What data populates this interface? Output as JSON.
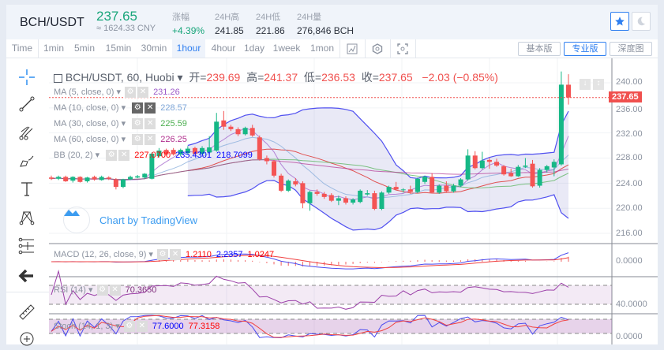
{
  "header": {
    "pair": "BCH/USDT",
    "last_price": "237.65",
    "cny": "≈ 1624.33 CNY",
    "stats": [
      {
        "label": "涨幅",
        "value": "+4.39%"
      },
      {
        "label": "24H高",
        "value": "241.85"
      },
      {
        "label": "24H低",
        "value": "221.86"
      },
      {
        "label": "24H量",
        "value": "276,846 BCH"
      }
    ],
    "favorite_icon": "star-icon",
    "theme_icon": "moon-icon"
  },
  "timeframes": [
    "Time",
    "1min",
    "5min",
    "15min",
    "30min",
    "1hour",
    "4hour",
    "1day",
    "1week",
    "1mon"
  ],
  "active_timeframe": "1hour",
  "view_buttons": [
    "基本版",
    "专业版",
    "深度图"
  ],
  "active_view": "专业版",
  "chart": {
    "title": "BCH/USDT, 60, Huobi",
    "ohlc": {
      "open_label": "开=",
      "open": "239.69",
      "high_label": "高=",
      "high": "241.37",
      "low_label": "低=",
      "low": "236.53",
      "close_label": "收=",
      "close": "237.65",
      "change": "−2.03 (−0.85%)"
    },
    "indicators": [
      {
        "label": "MA (5, close, 0)",
        "values": [
          "231.26"
        ],
        "color": "#9b59c8"
      },
      {
        "label": "MA (10, close, 0)",
        "values": [
          "228.57"
        ],
        "color": "#7ea6d8"
      },
      {
        "label": "MA (30, close, 0)",
        "values": [
          "225.59"
        ],
        "color": "#4caf50"
      },
      {
        "label": "MA (60, close, 0)",
        "values": [
          "226.25"
        ],
        "color": "#b0308e"
      },
      {
        "label": "BB (20, 2)",
        "values": [
          "227.0700",
          "235.4301",
          "218.7099"
        ],
        "color": "#0000ff"
      }
    ],
    "macd": {
      "label": "MACD (12, 26, close, 9)",
      "values": [
        "1.2110",
        "2.2357",
        "1.0247"
      ]
    },
    "rsi": {
      "label": "RSI (14)",
      "values": [
        "70.3650"
      ]
    },
    "stoch": {
      "label": "Stoch (14, 1, 3)",
      "values": [
        "77.6000",
        "77.3158"
      ]
    },
    "watermark": "Chart by TradingView",
    "price_ticks": [
      "240.00",
      "236.00",
      "232.00",
      "228.00",
      "224.00",
      "220.00",
      "216.00"
    ],
    "current_price_tag": "237.65",
    "macd_tick": "0.0000",
    "rsi_tick": "40.0000",
    "stoch_tick": "0.0000",
    "colors": {
      "up": "#16b886",
      "down": "#f45454",
      "accent": "#2f7ff0"
    }
  },
  "chart_data": {
    "type": "candlestick",
    "ylim": [
      215,
      241.5
    ],
    "ohlc": [
      [
        224.9,
        225.2,
        224.5,
        224.7
      ],
      [
        224.7,
        225.2,
        224.5,
        225.0
      ],
      [
        225.0,
        225.2,
        224.2,
        224.3
      ],
      [
        224.4,
        225.1,
        224.1,
        225.0
      ],
      [
        225.0,
        225.1,
        224.1,
        224.2
      ],
      [
        224.3,
        225.0,
        224.1,
        224.9
      ],
      [
        225.0,
        225.2,
        224.4,
        224.6
      ],
      [
        224.5,
        225.2,
        224.4,
        225.0
      ],
      [
        224.9,
        225.1,
        224.5,
        224.7
      ],
      [
        224.6,
        224.8,
        223.0,
        223.4
      ],
      [
        223.4,
        224.7,
        223.2,
        224.6
      ],
      [
        224.6,
        225.2,
        224.5,
        225.0
      ],
      [
        224.9,
        225.3,
        224.8,
        225.1
      ],
      [
        224.9,
        225.6,
        224.7,
        225.5
      ],
      [
        224.7,
        228.9,
        224.6,
        228.7
      ],
      [
        228.3,
        229.6,
        228.1,
        229.2
      ],
      [
        229.3,
        229.5,
        228.4,
        228.6
      ],
      [
        229.3,
        229.6,
        228.4,
        228.6
      ],
      [
        228.6,
        229.5,
        228.3,
        229.3
      ],
      [
        228.8,
        229.9,
        228.5,
        229.5
      ],
      [
        229.6,
        229.8,
        228.5,
        228.7
      ],
      [
        228.7,
        229.9,
        228.5,
        229.6
      ],
      [
        228.9,
        231.5,
        228.6,
        229.7
      ],
      [
        229.2,
        235.2,
        229.0,
        233.8
      ],
      [
        234.0,
        235.5,
        232.5,
        233.0
      ],
      [
        233.0,
        233.3,
        232.3,
        232.6
      ],
      [
        232.6,
        232.9,
        231.5,
        231.8
      ],
      [
        231.8,
        233.0,
        231.6,
        232.8
      ],
      [
        232.8,
        233.3,
        231.4,
        231.6
      ],
      [
        231.3,
        231.6,
        227.6,
        227.8
      ],
      [
        228.0,
        228.4,
        227.0,
        227.5
      ],
      [
        227.5,
        227.7,
        224.9,
        225.2
      ],
      [
        225.2,
        225.5,
        222.6,
        222.8
      ],
      [
        222.8,
        224.6,
        222.6,
        224.4
      ],
      [
        224.3,
        224.8,
        223.5,
        223.8
      ],
      [
        224.0,
        224.3,
        220.0,
        220.8
      ],
      [
        220.8,
        222.8,
        219.6,
        222.6
      ],
      [
        222.6,
        223.0,
        222.0,
        222.3
      ],
      [
        222.3,
        222.6,
        221.5,
        221.8
      ],
      [
        222.1,
        222.4,
        221.0,
        221.2
      ],
      [
        221.2,
        222.0,
        220.5,
        221.6
      ],
      [
        221.6,
        221.9,
        220.6,
        220.9
      ],
      [
        220.9,
        221.6,
        220.6,
        221.4
      ],
      [
        221.0,
        223.0,
        220.8,
        222.8
      ],
      [
        222.2,
        222.9,
        222.0,
        222.4
      ],
      [
        222.4,
        222.8,
        219.7,
        219.9
      ],
      [
        219.9,
        222.7,
        219.7,
        222.5
      ],
      [
        222.5,
        223.6,
        222.3,
        223.4
      ],
      [
        223.4,
        224.2,
        222.9,
        223.0
      ],
      [
        222.9,
        223.2,
        222.5,
        223.0
      ],
      [
        223.0,
        223.6,
        222.3,
        222.6
      ],
      [
        222.6,
        224.9,
        222.4,
        224.7
      ],
      [
        224.2,
        225.2,
        223.9,
        225.0
      ],
      [
        225.0,
        225.6,
        222.4,
        222.5
      ],
      [
        222.5,
        223.8,
        222.3,
        223.6
      ],
      [
        223.6,
        224.3,
        222.5,
        222.7
      ],
      [
        222.7,
        223.9,
        222.5,
        223.6
      ],
      [
        223.6,
        224.8,
        223.4,
        224.6
      ],
      [
        224.6,
        229.4,
        224.4,
        228.4
      ],
      [
        228.4,
        229.1,
        226.2,
        226.4
      ],
      [
        226.4,
        229.0,
        226.2,
        227.6
      ],
      [
        227.7,
        228.0,
        226.3,
        227.4
      ],
      [
        227.4,
        227.9,
        226.6,
        226.8
      ],
      [
        226.7,
        226.9,
        225.2,
        225.4
      ],
      [
        225.6,
        226.3,
        225.0,
        225.1
      ],
      [
        225.1,
        226.9,
        225.0,
        226.6
      ],
      [
        226.6,
        228.0,
        226.4,
        226.8
      ],
      [
        227.1,
        227.7,
        223.3,
        223.5
      ],
      [
        223.6,
        226.4,
        223.3,
        226.1
      ],
      [
        226.1,
        226.9,
        225.7,
        226.7
      ],
      [
        226.5,
        227.8,
        225.1,
        227.4
      ],
      [
        227.0,
        241.8,
        226.8,
        239.7
      ],
      [
        239.69,
        241.37,
        236.53,
        237.65
      ]
    ]
  }
}
